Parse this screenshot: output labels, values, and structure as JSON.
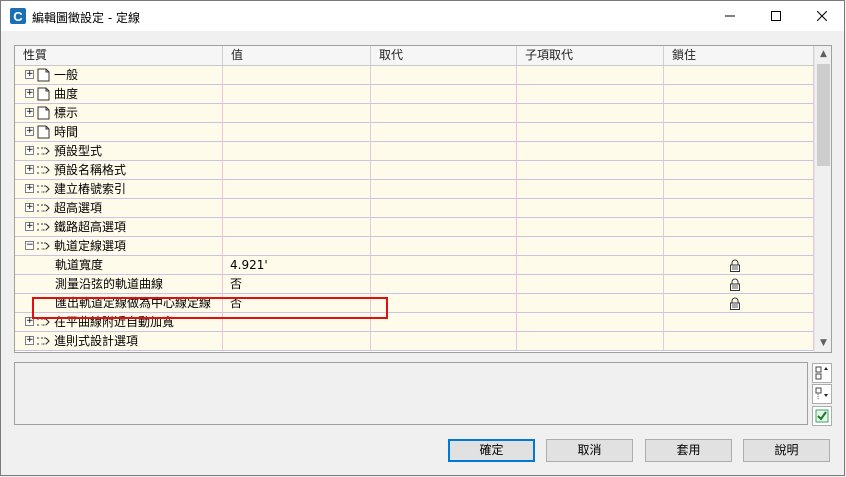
{
  "window": {
    "title": "編輯圖徵設定 - 定線"
  },
  "table": {
    "columns": [
      "性質",
      "值",
      "取代",
      "子項取代",
      "鎖住"
    ],
    "rows": [
      {
        "label": "一般",
        "type": "group-page",
        "value": "",
        "locked": false
      },
      {
        "label": "曲度",
        "type": "group-page",
        "value": "",
        "locked": false
      },
      {
        "label": "標示",
        "type": "group-page",
        "value": "",
        "locked": false
      },
      {
        "label": "時間",
        "type": "group-page",
        "value": "",
        "locked": false
      },
      {
        "label": "預設型式",
        "type": "group-style",
        "value": "",
        "locked": false
      },
      {
        "label": "預設名稱格式",
        "type": "group-style",
        "value": "",
        "locked": false
      },
      {
        "label": "建立樁號索引",
        "type": "group-style",
        "value": "",
        "locked": false
      },
      {
        "label": "超高選項",
        "type": "group-style",
        "value": "",
        "locked": false
      },
      {
        "label": "鐵路超高選項",
        "type": "group-style",
        "value": "",
        "locked": false
      },
      {
        "label": "軌道定線選項",
        "type": "group-style-open",
        "value": "",
        "locked": false
      },
      {
        "label": "軌道寬度",
        "type": "child",
        "value": "4.921'",
        "locked": true
      },
      {
        "label": "測量沿弦的軌道曲線",
        "type": "child",
        "value": "否",
        "locked": true
      },
      {
        "label": "匯出軌道定線做為中心線定線",
        "type": "child",
        "value": "否",
        "locked": true
      },
      {
        "label": "在平曲線附近自動加寬",
        "type": "group-style",
        "value": "",
        "locked": false
      },
      {
        "label": "進則式設計選項",
        "type": "group-style",
        "value": "",
        "locked": false
      }
    ]
  },
  "buttons": {
    "ok": "確定",
    "cancel": "取消",
    "apply": "套用",
    "help": "說明"
  },
  "colors": {
    "row_bg": "#fffbea",
    "highlight": "#e01010",
    "accent": "#0078d7"
  }
}
